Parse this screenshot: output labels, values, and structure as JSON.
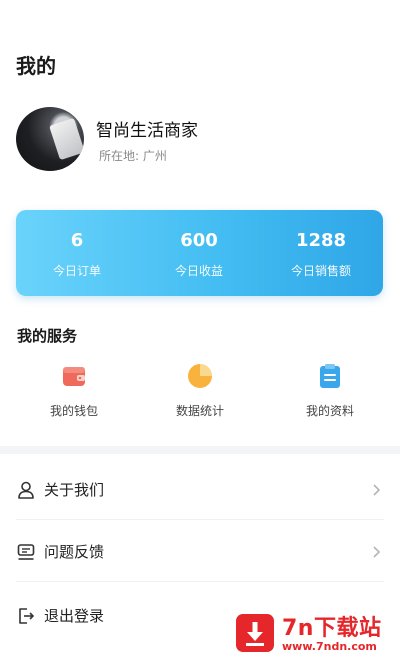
{
  "header": {
    "title": "我的"
  },
  "profile": {
    "name": "智尚生活商家",
    "location_label": "所在地:",
    "location_value": "广州"
  },
  "stats": [
    {
      "value": "6",
      "label": "今日订单"
    },
    {
      "value": "600",
      "label": "今日收益"
    },
    {
      "value": "1288",
      "label": "今日销售额"
    }
  ],
  "services": {
    "title": "我的服务",
    "items": [
      {
        "label": "我的钱包",
        "icon": "wallet-icon"
      },
      {
        "label": "数据统计",
        "icon": "pie-chart-icon"
      },
      {
        "label": "我的资料",
        "icon": "clipboard-icon"
      }
    ]
  },
  "menu": [
    {
      "label": "关于我们",
      "icon": "user-icon"
    },
    {
      "label": "问题反馈",
      "icon": "feedback-icon"
    },
    {
      "label": "退出登录",
      "icon": "logout-icon"
    }
  ],
  "watermark": {
    "title": "7n下载站",
    "url": "www.7ndn.com"
  },
  "colors": {
    "card_gradient_start": "#6ad3fb",
    "card_gradient_end": "#2fa6e7",
    "wallet": "#f06a5b",
    "pie": "#f7b33d",
    "clipboard": "#3aa6ec",
    "watermark": "#e5262a"
  }
}
